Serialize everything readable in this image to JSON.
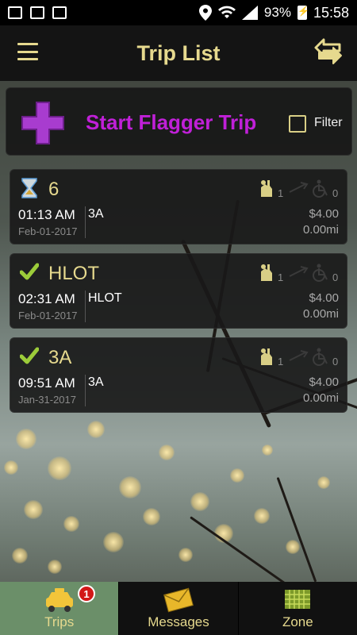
{
  "status_bar": {
    "battery": "93%",
    "time": "15:58"
  },
  "app_bar": {
    "title": "Trip List"
  },
  "flagger": {
    "label": "Start Flagger Trip",
    "filter_label": "Filter",
    "filter_checked": false
  },
  "trips": [
    {
      "status": "hourglass-icon",
      "name": "6",
      "time": "01:13 AM",
      "date": "Feb-01-2017",
      "zone": "3A",
      "hand_count": "1",
      "wheelchair_count": "0",
      "fare": "$4.00",
      "distance": "0.00mi"
    },
    {
      "status": "check-icon",
      "name": "HLOT",
      "time": "02:31 AM",
      "date": "Feb-01-2017",
      "zone": "HLOT",
      "hand_count": "1",
      "wheelchair_count": "0",
      "fare": "$4.00",
      "distance": "0.00mi"
    },
    {
      "status": "check-icon",
      "name": "3A",
      "time": "09:51 AM",
      "date": "Jan-31-2017",
      "zone": "3A",
      "hand_count": "1",
      "wheelchair_count": "0",
      "fare": "$4.00",
      "distance": "0.00mi"
    }
  ],
  "bottom_nav": {
    "items": [
      {
        "label": "Trips",
        "icon": "taxi-icon",
        "badge": "1",
        "active": true
      },
      {
        "label": "Messages",
        "icon": "envelope-icon",
        "active": false
      },
      {
        "label": "Zone",
        "icon": "zone-map-icon",
        "active": false
      }
    ]
  },
  "colors": {
    "accent": "#e6d98e",
    "flagger_text": "#c020d8",
    "active_tab": "#6b8f69",
    "badge": "#d21818"
  }
}
